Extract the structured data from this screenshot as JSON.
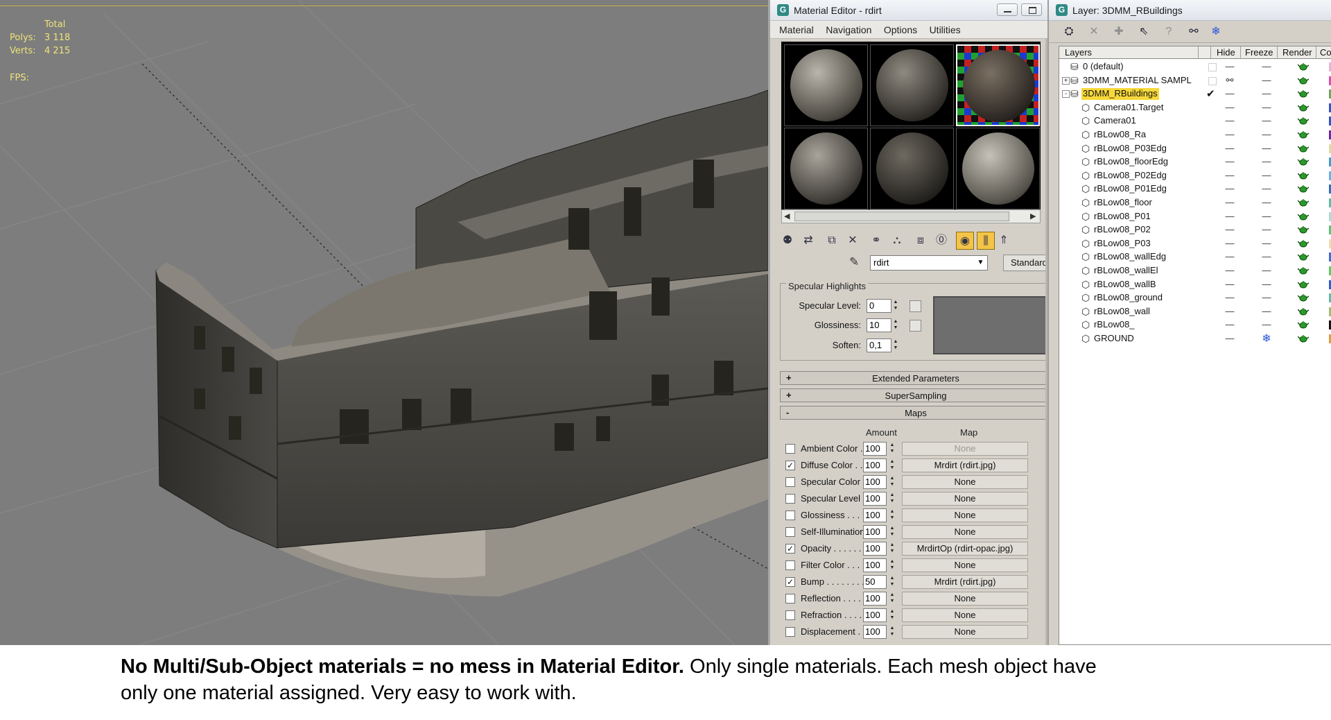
{
  "viewport": {
    "stats": {
      "header": "Total",
      "polys_label": "Polys:",
      "polys_value": "3 118",
      "verts_label": "Verts:",
      "verts_value": "4 215",
      "fps_label": "FPS:"
    }
  },
  "material_editor": {
    "title": "Material Editor - rdirt",
    "menu": [
      "Material",
      "Navigation",
      "Options",
      "Utilities"
    ],
    "samples": [
      {
        "color_light": "#b9b5ab",
        "color_dark": "#4a4740"
      },
      {
        "color_light": "#8f8a80",
        "color_dark": "#2f2c28"
      },
      {
        "color_light": "#7a6f62",
        "color_dark": "#2a2521"
      },
      {
        "color_light": "#a9a49a",
        "color_dark": "#3c3935"
      },
      {
        "color_light": "#6e6a60",
        "color_dark": "#24221f"
      },
      {
        "color_light": "#c6c2b8",
        "color_dark": "#55524b"
      }
    ],
    "material_name": "rdirt",
    "material_type": "Standard",
    "specular": {
      "group_title": "Specular Highlights",
      "level_label": "Specular Level:",
      "level_value": "0",
      "gloss_label": "Glossiness:",
      "gloss_value": "10",
      "soften_label": "Soften:",
      "soften_value": "0,1"
    },
    "rollouts": {
      "extended": "Extended Parameters",
      "supersampling": "SuperSampling",
      "maps": "Maps",
      "plus": "+",
      "minus": "-"
    },
    "maps_header": {
      "amount": "Amount",
      "map": "Map"
    },
    "maps": [
      {
        "checked": false,
        "label": "Ambient Color . . .",
        "amount": "100",
        "map": "None",
        "disabled": true
      },
      {
        "checked": true,
        "label": "Diffuse Color . . . .",
        "amount": "100",
        "map": "Mrdirt (rdirt.jpg)",
        "disabled": false
      },
      {
        "checked": false,
        "label": "Specular Color . . .",
        "amount": "100",
        "map": "None",
        "disabled": false
      },
      {
        "checked": false,
        "label": "Specular Level . . .",
        "amount": "100",
        "map": "None",
        "disabled": false
      },
      {
        "checked": false,
        "label": "Glossiness . . . . . .",
        "amount": "100",
        "map": "None",
        "disabled": false
      },
      {
        "checked": false,
        "label": "Self-Illumination . .",
        "amount": "100",
        "map": "None",
        "disabled": false
      },
      {
        "checked": true,
        "label": "Opacity . . . . . . . .",
        "amount": "100",
        "map": "MrdirtOp (rdirt-opac.jpg)",
        "disabled": false
      },
      {
        "checked": false,
        "label": "Filter Color . . . . .",
        "amount": "100",
        "map": "None",
        "disabled": false
      },
      {
        "checked": true,
        "label": "Bump . . . . . . . . .",
        "amount": "50",
        "map": "Mrdirt (rdirt.jpg)",
        "disabled": false
      },
      {
        "checked": false,
        "label": "Reflection . . . . . .",
        "amount": "100",
        "map": "None",
        "disabled": false
      },
      {
        "checked": false,
        "label": "Refraction . . . . . .",
        "amount": "100",
        "map": "None",
        "disabled": false
      },
      {
        "checked": false,
        "label": "Displacement . . . .",
        "amount": "100",
        "map": "None",
        "disabled": false
      }
    ]
  },
  "layer_manager": {
    "title": "Layer: 3DMM_RBuildings",
    "columns": [
      "Layers",
      "Hide",
      "Freeze",
      "Render",
      "Co"
    ],
    "rows": [
      {
        "name": "0 (default)",
        "level": 0,
        "expander": "",
        "selected": false,
        "current": false,
        "freeze": "dash",
        "color": "#e0b8d8"
      },
      {
        "name": "3DMM_MATERIAL SAMPL",
        "level": 0,
        "expander": "+",
        "selected": false,
        "current": false,
        "hidden": true,
        "freeze": "dash",
        "color": "#d850b0"
      },
      {
        "name": "3DMM_RBuildings",
        "level": 0,
        "expander": "-",
        "selected": true,
        "current": true,
        "freeze": "dash",
        "color": "#6aa860"
      },
      {
        "name": "Camera01.Target",
        "level": 1,
        "expander": "",
        "selected": false,
        "current": false,
        "freeze": "dash",
        "color": "#2a58c8"
      },
      {
        "name": "Camera01",
        "level": 1,
        "expander": "",
        "selected": false,
        "current": false,
        "freeze": "dash",
        "color": "#2a58c8"
      },
      {
        "name": "rBLow08_Ra",
        "level": 1,
        "expander": "",
        "selected": false,
        "current": false,
        "freeze": "dash",
        "color": "#6a2ab0"
      },
      {
        "name": "rBLow08_P03Edg",
        "level": 1,
        "expander": "",
        "selected": false,
        "current": false,
        "freeze": "dash",
        "color": "#d8e0a0"
      },
      {
        "name": "rBLow08_floorEdg",
        "level": 1,
        "expander": "",
        "selected": false,
        "current": false,
        "freeze": "dash",
        "color": "#3aa0d0"
      },
      {
        "name": "rBLow08_P02Edg",
        "level": 1,
        "expander": "",
        "selected": false,
        "current": false,
        "freeze": "dash",
        "color": "#60b8e8"
      },
      {
        "name": "rBLow08_P01Edg",
        "level": 1,
        "expander": "",
        "selected": false,
        "current": false,
        "freeze": "dash",
        "color": "#2a70c0"
      },
      {
        "name": "rBLow08_floor",
        "level": 1,
        "expander": "",
        "selected": false,
        "current": false,
        "freeze": "dash",
        "color": "#58c0a0"
      },
      {
        "name": "rBLow08_P01",
        "level": 1,
        "expander": "",
        "selected": false,
        "current": false,
        "freeze": "dash",
        "color": "#a0e0d8"
      },
      {
        "name": "rBLow08_P02",
        "level": 1,
        "expander": "",
        "selected": false,
        "current": false,
        "freeze": "dash",
        "color": "#58c878"
      },
      {
        "name": "rBLow08_P03",
        "level": 1,
        "expander": "",
        "selected": false,
        "current": false,
        "freeze": "dash",
        "color": "#e8e0b0"
      },
      {
        "name": "rBLow08_wallEdg",
        "level": 1,
        "expander": "",
        "selected": false,
        "current": false,
        "freeze": "dash",
        "color": "#3a70d8"
      },
      {
        "name": "rBLow08_wallEl",
        "level": 1,
        "expander": "",
        "selected": false,
        "current": false,
        "freeze": "dash",
        "color": "#58d060"
      },
      {
        "name": "rBLow08_wallB",
        "level": 1,
        "expander": "",
        "selected": false,
        "current": false,
        "freeze": "dash",
        "color": "#2a60d0"
      },
      {
        "name": "rBLow08_ground",
        "level": 1,
        "expander": "",
        "selected": false,
        "current": false,
        "freeze": "dash",
        "color": "#58c0a8"
      },
      {
        "name": "rBLow08_wall",
        "level": 1,
        "expander": "",
        "selected": false,
        "current": false,
        "freeze": "dash",
        "color": "#a0c070"
      },
      {
        "name": "rBLow08_",
        "level": 1,
        "expander": "",
        "selected": false,
        "current": false,
        "freeze": "dash",
        "color": "#101010"
      },
      {
        "name": "GROUND",
        "level": 1,
        "expander": "",
        "selected": false,
        "current": false,
        "freeze": "snow",
        "color": "#d8a040"
      }
    ]
  },
  "caption": {
    "bold": "No Multi/Sub-Object materials = no mess in Material Editor.",
    "line1_rest": " Only single materials. Each mesh object have",
    "line2": "only one material assigned. Very easy to work with."
  },
  "icons": [
    "max-app-icon",
    "minimize-icon",
    "maximize-icon",
    "eyedropper-icon",
    "dropdown-arrow-icon",
    "teapot-render-icon",
    "snowflake-freeze-icon",
    "glasses-hide-icon",
    "check-icon",
    "expand-plus-icon",
    "collapse-minus-icon",
    "object-icon",
    "layer-icon"
  ]
}
